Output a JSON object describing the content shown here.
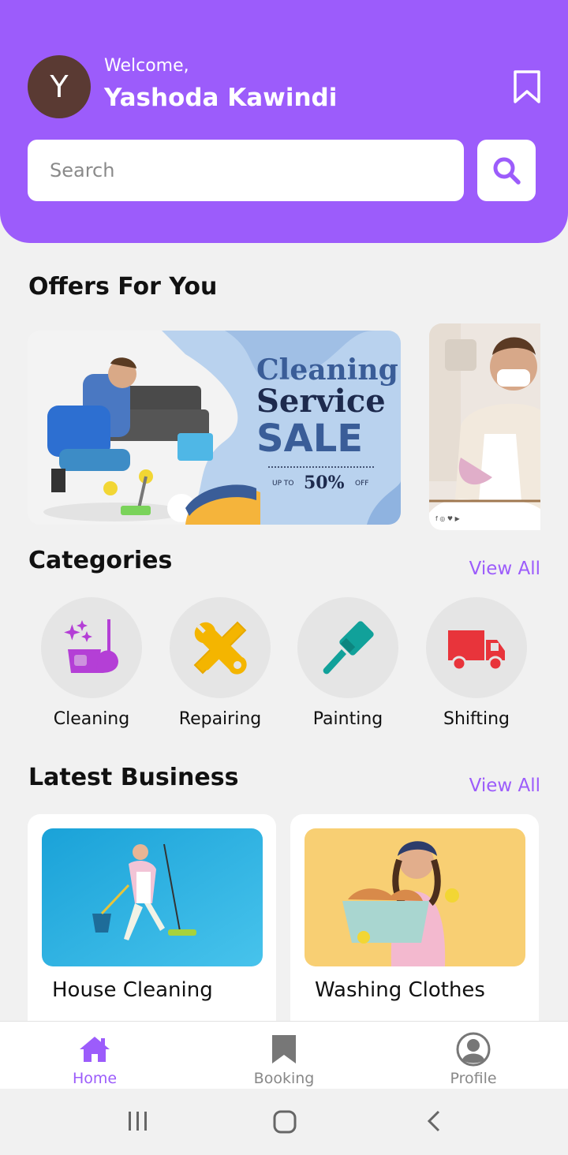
{
  "header": {
    "avatar_initial": "Y",
    "welcome_text": "Welcome,",
    "user_name": "Yashoda Kawindi",
    "bookmark_icon": "bookmark-icon"
  },
  "search": {
    "placeholder": "Search",
    "button_icon": "search-icon"
  },
  "offers": {
    "title": "Offers For You",
    "banners": [
      {
        "line1": "Cleaning",
        "line2": "Service",
        "line3": "SALE",
        "up_to": "UP TO",
        "percent": "50%",
        "off": "OFF"
      },
      {
        "social": "f ◎ ♥ ▶"
      }
    ]
  },
  "categories": {
    "title": "Categories",
    "view_all": "View All",
    "items": [
      {
        "label": "Cleaning",
        "icon": "cleaning-icon"
      },
      {
        "label": "Repairing",
        "icon": "repair-tools-icon"
      },
      {
        "label": "Painting",
        "icon": "paint-brush-icon"
      },
      {
        "label": "Shifting",
        "icon": "truck-icon"
      }
    ]
  },
  "latest": {
    "title": "Latest Business",
    "view_all": "View All",
    "items": [
      {
        "name": "House Cleaning"
      },
      {
        "name": "Washing Clothes"
      }
    ]
  },
  "nav": {
    "items": [
      {
        "label": "Home",
        "icon": "home-icon",
        "active": true
      },
      {
        "label": "Booking",
        "icon": "bookmark-icon",
        "active": false
      },
      {
        "label": "Profile",
        "icon": "user-icon",
        "active": false
      }
    ]
  },
  "colors": {
    "accent": "#9c5cfb",
    "background": "#f1f1f1"
  }
}
